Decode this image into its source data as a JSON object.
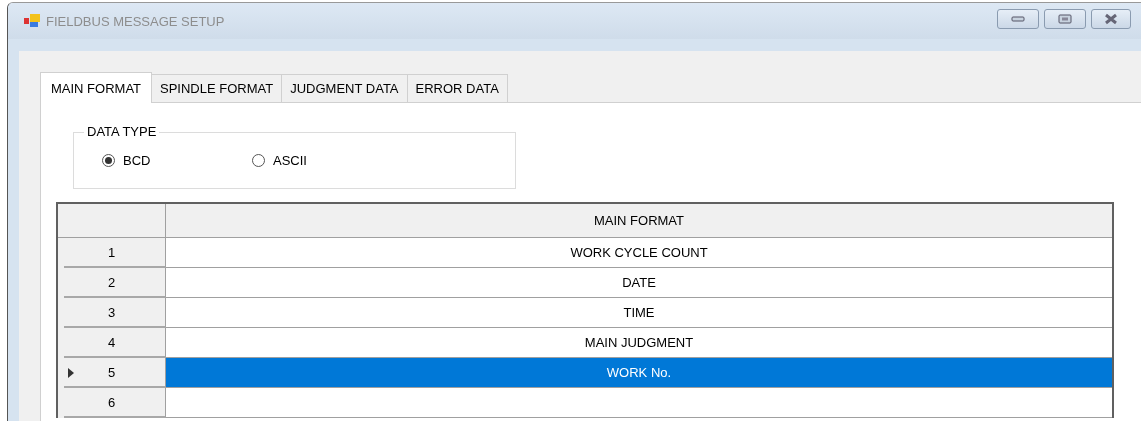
{
  "window": {
    "title": "FIELDBUS MESSAGE SETUP"
  },
  "tabs": [
    {
      "label": "MAIN FORMAT",
      "selected": true
    },
    {
      "label": "SPINDLE FORMAT",
      "selected": false
    },
    {
      "label": "JUDGMENT DATA",
      "selected": false
    },
    {
      "label": "ERROR DATA",
      "selected": false
    }
  ],
  "data_type": {
    "label": "DATA TYPE",
    "options": [
      {
        "label": "BCD",
        "selected": true
      },
      {
        "label": "ASCII",
        "selected": false
      }
    ]
  },
  "table": {
    "columns": [
      "MAIN FORMAT"
    ],
    "rows": [
      {
        "number": "1",
        "value": "WORK CYCLE COUNT",
        "selected": false
      },
      {
        "number": "2",
        "value": "DATE",
        "selected": false
      },
      {
        "number": "3",
        "value": "TIME",
        "selected": false
      },
      {
        "number": "4",
        "value": "MAIN JUDGMENT",
        "selected": false
      },
      {
        "number": "5",
        "value": "WORK No.",
        "selected": true
      },
      {
        "number": "6",
        "selected": false
      }
    ]
  }
}
